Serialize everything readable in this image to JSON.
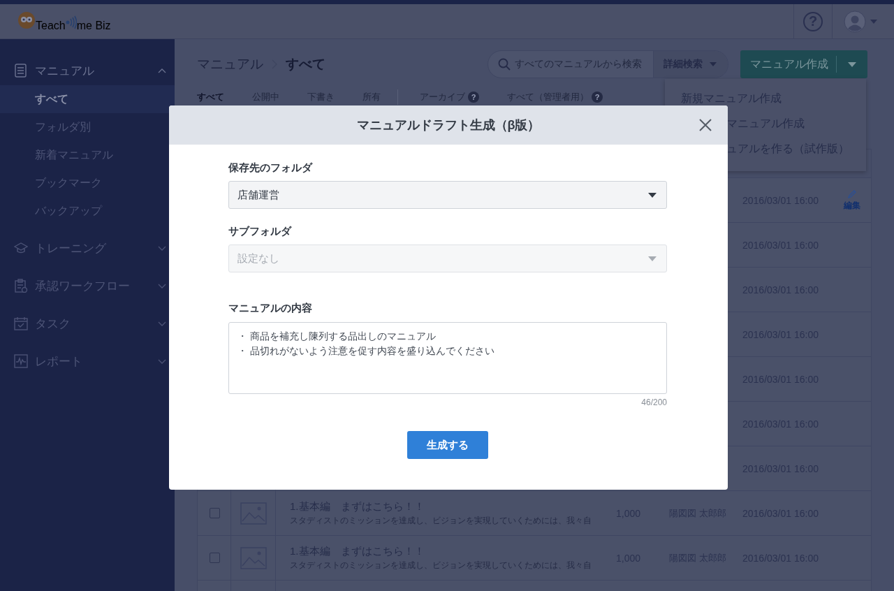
{
  "header": {
    "logo_prefix": "Teach",
    "logo_suffix": "me Biz",
    "help": "?"
  },
  "sidebar": {
    "sections": [
      {
        "label": "マニュアル",
        "kind": "notebook",
        "expanded": true,
        "children": [
          {
            "label": "すべて",
            "selected": true
          },
          {
            "label": "フォルダ別",
            "selected": false
          },
          {
            "label": "新着マニュアル",
            "selected": false
          },
          {
            "label": "ブックマーク",
            "selected": false
          },
          {
            "label": "バックアップ",
            "selected": false
          }
        ]
      },
      {
        "label": "トレーニング",
        "kind": "cap",
        "expanded": false
      },
      {
        "label": "承認ワークフロー",
        "kind": "clipboard",
        "expanded": false
      },
      {
        "label": "タスク",
        "kind": "calendar",
        "expanded": false
      },
      {
        "label": "レポート",
        "kind": "chart",
        "expanded": false
      }
    ]
  },
  "breadcrumb": [
    "マニュアル",
    "すべて"
  ],
  "search": {
    "placeholder": "すべてのマニュアルから検索",
    "advanced": "詳細検索"
  },
  "create_button": {
    "label": "マニュアル作成"
  },
  "create_menu": [
    {
      "label": "新規マニュアル作成",
      "kind": "full"
    },
    {
      "label": "マニュアル作成",
      "kind": "cut"
    },
    {
      "label": "ュアルを作る（試作版）",
      "kind": "cut"
    }
  ],
  "tabs": [
    {
      "label": "すべて",
      "selected": true,
      "kind": "status"
    },
    {
      "label": "公開中",
      "selected": false,
      "kind": "status"
    },
    {
      "label": "下書き",
      "selected": false,
      "kind": "status"
    },
    {
      "label": "所有",
      "selected": false,
      "kind": "status"
    },
    {
      "label": "アーカイブ",
      "selected": false,
      "kind": "admin",
      "help": "?"
    },
    {
      "label": "すべて（管理者用）",
      "selected": false,
      "kind": "admin",
      "help": "?"
    }
  ],
  "table": {
    "rows": [
      {
        "date": "2016/03/01 16:00",
        "action": "編集"
      },
      {
        "date": "2016/03/01 16:00"
      },
      {
        "date": "2016/03/01 16:00"
      },
      {
        "date": "2016/03/01 16:00"
      },
      {
        "date": "2016/03/01 16:00"
      },
      {
        "date": "2016/03/01 16:00"
      },
      {
        "date": "2016/03/01 16:00"
      },
      {
        "checked": false,
        "title": "1.基本編　まずはこちら！！",
        "description": "スタディストのミッションを達成し、ビジョンを実現していくためには、我々自",
        "views": "1,000",
        "author": "陽図図 太郎郎",
        "date": "2016/03/01 16:00"
      },
      {
        "checked": false,
        "title": "1.基本編　まずはこちら！！",
        "description": "スタディストのミッションを達成し、ビジョンを実現していくためには、我々自",
        "views": "1,000",
        "author": "陽図図 太郎郎",
        "date": "2016/03/01 16:00"
      }
    ]
  },
  "modal": {
    "title": "マニュアルドラフト生成（β版）",
    "fields": [
      {
        "kind": "select",
        "label": "保存先のフォルダ",
        "value": "店舗運営",
        "disabled": false
      },
      {
        "kind": "select",
        "label": "サブフォルダ",
        "placeholder": "設定なし",
        "disabled": true
      },
      {
        "kind": "textarea",
        "label": "マニュアルの内容",
        "lines": [
          "・ 商品を補充し陳列する品出しのマニュアル",
          "・ 品切れがないよう注意を促す内容を盛り込んでください"
        ],
        "counter": "46/200"
      }
    ],
    "submit": "生成する"
  }
}
